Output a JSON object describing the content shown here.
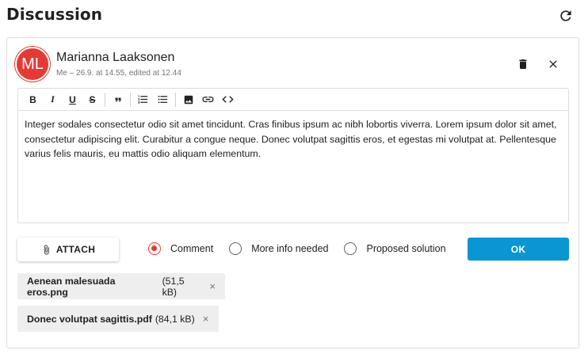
{
  "header": {
    "title": "Discussion",
    "refresh_icon": "refresh-icon"
  },
  "comment": {
    "avatar_initials": "ML",
    "avatar_color": "#e53935",
    "author": "Marianna Laaksonen",
    "meta": "Me – 26.9. at 14.55, edited at 12.44",
    "delete_icon": "trash-icon",
    "close_icon": "close-icon"
  },
  "toolbar": {
    "bold": "B",
    "italic": "I",
    "underline": "U",
    "strike": "S",
    "quote": "❞",
    "items": [
      "bold",
      "italic",
      "underline",
      "strikethrough",
      "blockquote",
      "numbered-list",
      "bulleted-list",
      "image",
      "link",
      "code"
    ]
  },
  "editor": {
    "text": "Integer sodales consectetur odio sit amet tincidunt. Cras finibus ipsum ac nibh lobortis viverra. Lorem ipsum dolor sit amet, consectetur adipiscing elit. Curabitur a congue neque. Donec volutpat sagittis eros, et egestas mi volutpat at. Pellentesque varius felis mauris, eu mattis odio aliquam elementum."
  },
  "actions": {
    "attach_label": "ATTACH",
    "ok_label": "OK",
    "ok_color": "#0a95d3"
  },
  "comment_types": [
    {
      "label": "Comment",
      "checked": true
    },
    {
      "label": "More info needed",
      "checked": false
    },
    {
      "label": "Proposed solution",
      "checked": false
    }
  ],
  "attachments": [
    {
      "name": "Aenean malesuada eros.png",
      "size": "(51,5 kB)"
    },
    {
      "name": "Donec volutpat sagittis.pdf",
      "size": "(84,1 kB)"
    }
  ],
  "remove_glyph": "×"
}
